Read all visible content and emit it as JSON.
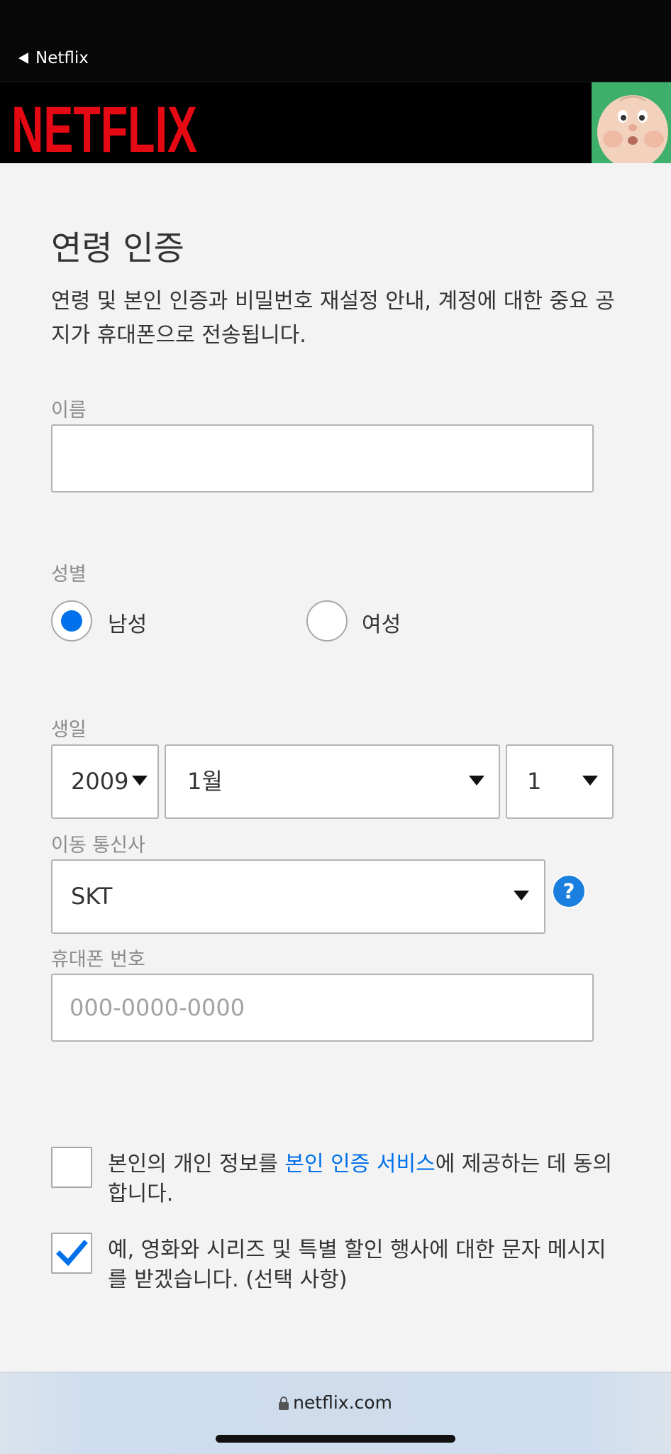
{
  "status_bar": {
    "back_label": "Netflix"
  },
  "header": {
    "logo_text": "NETFLIX",
    "brand_color": "#e50914"
  },
  "page": {
    "title": "연령 인증",
    "description": "연령 및 본인 인증과 비밀번호 재설정 안내, 계정에 대한 중요 공지가 휴대폰으로 전송됩니다."
  },
  "form": {
    "name": {
      "label": "이름",
      "value": ""
    },
    "gender": {
      "label": "성별",
      "options": [
        {
          "label": "남성",
          "selected": true
        },
        {
          "label": "여성",
          "selected": false
        }
      ]
    },
    "birthday": {
      "label": "생일",
      "year": "2009",
      "month": "1월",
      "day": "1"
    },
    "carrier": {
      "label": "이동 통신사",
      "value": "SKT",
      "help": "?"
    },
    "phone": {
      "label": "휴대폰 번호",
      "placeholder": "000-0000-0000",
      "value": ""
    }
  },
  "consents": [
    {
      "checked": false,
      "text_before": "본인의 개인 정보를 ",
      "link_text": "본인 인증 서비스",
      "text_after": "에 제공하는 데 동의합니다."
    },
    {
      "checked": true,
      "text": "예, 영화와 시리즈 및 특별 할인 행사에 대한 문자 메시지를 받겠습니다. (선택 사항)"
    }
  ],
  "browser": {
    "url": "netflix.com",
    "lock_icon": "lock-icon"
  },
  "colors": {
    "accent": "#0071eb",
    "help_badge": "#1a7fde"
  }
}
